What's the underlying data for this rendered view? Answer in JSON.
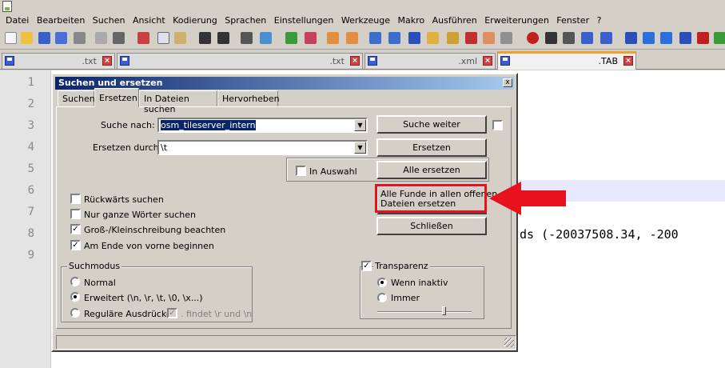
{
  "menu": [
    "Datei",
    "Bearbeiten",
    "Suchen",
    "Ansicht",
    "Kodierung",
    "Sprachen",
    "Einstellungen",
    "Werkzeuge",
    "Makro",
    "Ausführen",
    "Erweiterungen",
    "Fenster",
    "?"
  ],
  "tabs": [
    {
      "name": ".txt"
    },
    {
      "name": ".txt"
    },
    {
      "name": ".xml"
    },
    {
      "name": ".TAB"
    }
  ],
  "editor": {
    "line_numbers": [
      "1",
      "2",
      "3",
      "4",
      "5",
      "6",
      "7",
      "8",
      "9"
    ],
    "visible_text": "ds (-20037508.34, -200"
  },
  "dialog": {
    "title": "Suchen und ersetzen",
    "close": "x",
    "tabs": [
      "Suchen",
      "Ersetzen",
      "In Dateien suchen",
      "Hervorheben"
    ],
    "find_label": "Suche nach:",
    "find_value": "osm_tileserver_intern",
    "replace_label": "Ersetzen durch:",
    "replace_value": "\\t",
    "in_selection": "In Auswahl",
    "buttons": {
      "find_next": "Suche weiter",
      "replace": "Ersetzen",
      "replace_all": "Alle ersetzen",
      "replace_all_open_line1": "Alle Funde in allen offenen",
      "replace_all_open_line2": "Dateien ersetzen",
      "close": "Schließen"
    },
    "options": [
      {
        "label": "Rückwärts suchen",
        "checked": false
      },
      {
        "label": "Nur ganze Wörter suchen",
        "checked": false
      },
      {
        "label": "Groß-/Kleinschreibung beachten",
        "checked": true
      },
      {
        "label": "Am Ende von vorne beginnen",
        "checked": true
      }
    ],
    "search_mode": {
      "title": "Suchmodus",
      "normal": "Normal",
      "extended": "Erweitert (\\n, \\r, \\t, \\0, \\x...)",
      "regex": "Reguläre Ausdrücke",
      "dot_matches": ". findet \\r und \\n",
      "selected": "extended"
    },
    "transparency": {
      "title": "Transparenz",
      "checked": true,
      "on_inactive": "Wenn inaktiv",
      "always": "Immer",
      "selected": "on_inactive"
    }
  },
  "colors": {
    "highlight": "#e8121f",
    "title_bar": "#0a246a"
  }
}
